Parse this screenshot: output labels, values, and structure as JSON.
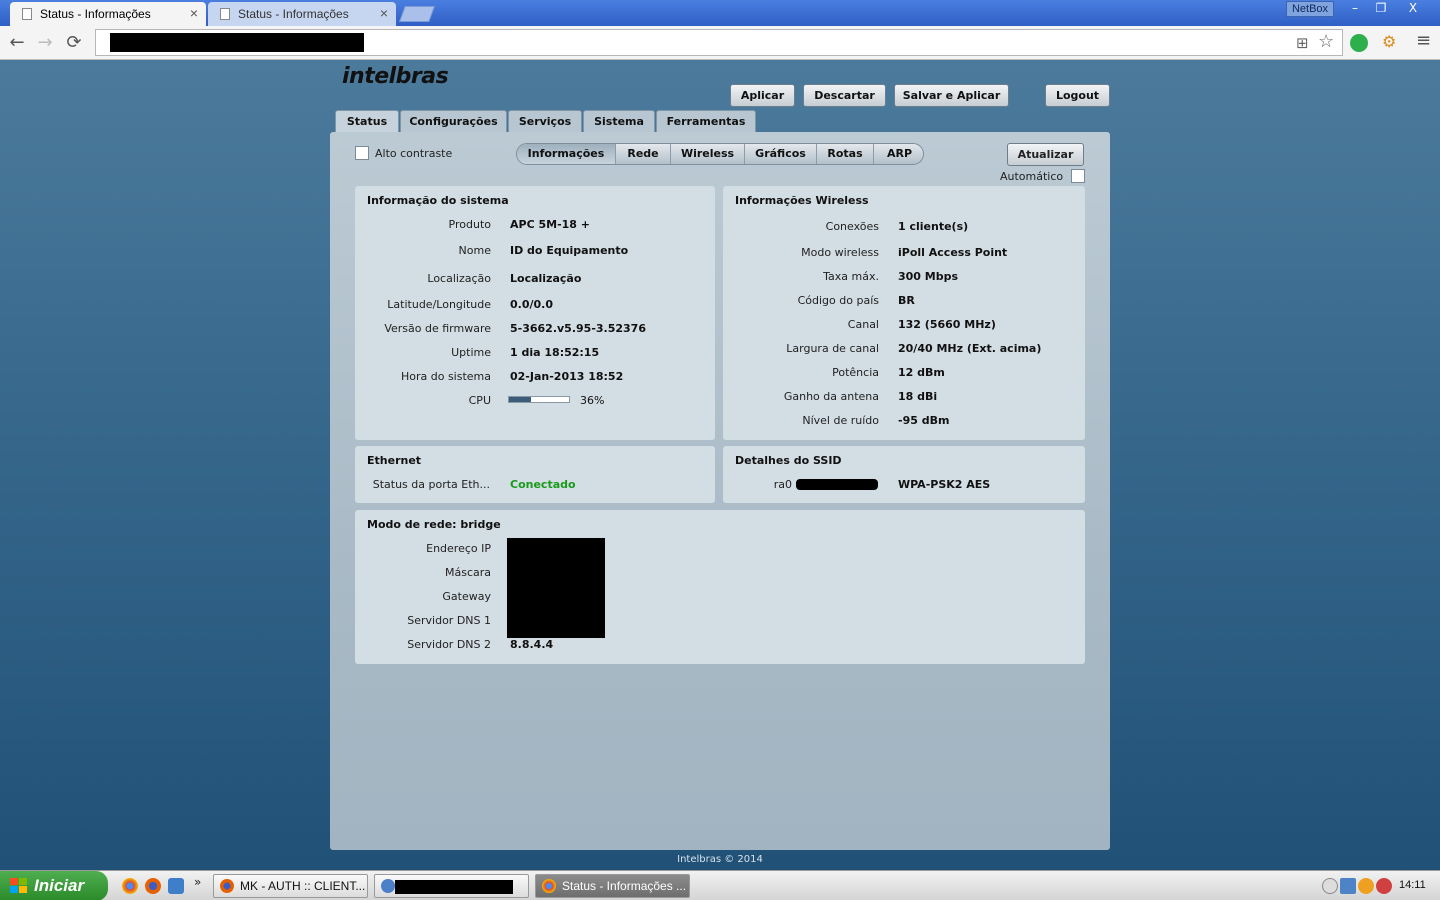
{
  "browser": {
    "tabs": [
      {
        "title": "Status - Informações",
        "close": "×"
      },
      {
        "title": "Status - Informações",
        "close": "×"
      }
    ],
    "profile_label": "NetBox",
    "window_buttons": {
      "minimize": "–",
      "restore": "❐",
      "close": "X"
    },
    "nav": {
      "back": "←",
      "forward": "→",
      "reload": "⟳",
      "menu": "≡",
      "star": "☆"
    }
  },
  "logo": "intelbras",
  "actions": {
    "apply": "Aplicar",
    "discard": "Descartar",
    "save_apply": "Salvar e Aplicar",
    "logout": "Logout"
  },
  "main_tabs": [
    "Status",
    "Configurações",
    "Serviços",
    "Sistema",
    "Ferramentas"
  ],
  "high_contrast_label": "Alto contraste",
  "sub_tabs": [
    "Informações",
    "Rede",
    "Wireless",
    "Gráficos",
    "Rotas",
    "ARP"
  ],
  "refresh_label": "Atualizar",
  "auto_label": "Automático",
  "system_info": {
    "title": "Informação do sistema",
    "rows": [
      {
        "label": "Produto",
        "value": "APC 5M-18 +"
      },
      {
        "label": "Nome",
        "value": "ID do Equipamento"
      },
      {
        "label": "Localização",
        "value": "Localização"
      },
      {
        "label": "Latitude/Longitude",
        "value": "0.0/0.0"
      },
      {
        "label": "Versão de firmware",
        "value": "5-3662.v5.95-3.52376"
      },
      {
        "label": "Uptime",
        "value": "1 dia 18:52:15"
      },
      {
        "label": "Hora do sistema",
        "value": "02-Jan-2013 18:52"
      },
      {
        "label": "CPU",
        "value": "36%"
      }
    ],
    "cpu_fraction": 0.36
  },
  "wireless_info": {
    "title": "Informações Wireless",
    "rows": [
      {
        "label": "Conexões",
        "value": "1 cliente(s)"
      },
      {
        "label": "Modo wireless",
        "value": "iPoll Access Point"
      },
      {
        "label": "Taxa máx.",
        "value": "300 Mbps"
      },
      {
        "label": "Código do país",
        "value": "BR"
      },
      {
        "label": "Canal",
        "value": "132 (5660 MHz)"
      },
      {
        "label": "Largura de canal",
        "value": "20/40 MHz (Ext. acima)"
      },
      {
        "label": "Potência",
        "value": "12 dBm"
      },
      {
        "label": "Ganho da antena",
        "value": "18 dBi"
      },
      {
        "label": "Nível de ruído",
        "value": "-95 dBm"
      }
    ]
  },
  "ethernet": {
    "title": "Ethernet",
    "label": "Status da porta Eth...",
    "value": "Conectado"
  },
  "ssid": {
    "title": "Detalhes do SSID",
    "iface": "ra0",
    "security": "WPA-PSK2 AES"
  },
  "network": {
    "title": "Modo de rede: bridge",
    "labels": [
      "Endereço IP",
      "Máscara",
      "Gateway",
      "Servidor DNS 1",
      "Servidor DNS 2"
    ],
    "dns2": "8.8.4.4"
  },
  "footer": "Intelbras © 2014",
  "taskbar": {
    "start": "Iniciar",
    "tasks": [
      "MK - AUTH :: CLIENT...",
      "",
      "Status - Informações ..."
    ],
    "clock": "14:11"
  }
}
